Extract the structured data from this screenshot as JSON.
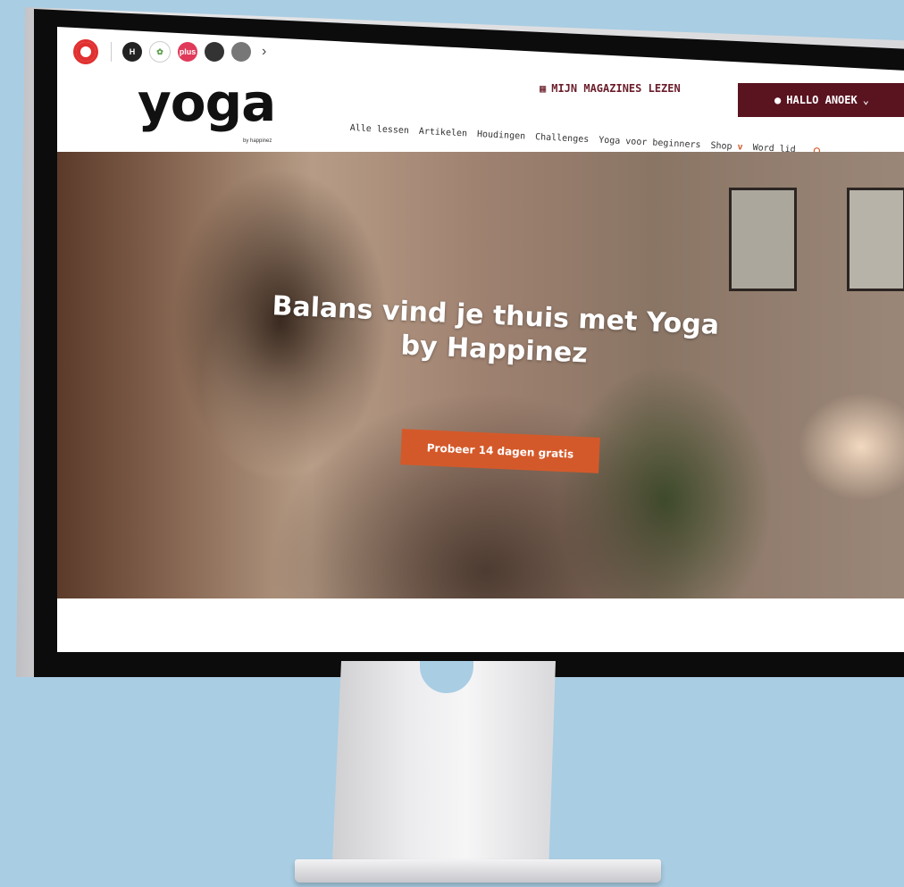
{
  "brands": [
    {
      "name": "opzij-icon",
      "color": "#e03030",
      "label": ""
    },
    {
      "name": "happinez-icon",
      "color": "#222",
      "label": "H"
    },
    {
      "name": "libelle-icon",
      "color": "#5a9e4a",
      "label": ""
    },
    {
      "name": "plus-icon",
      "color": "#e03a5a",
      "label": "plus"
    },
    {
      "name": "brand-dark-icon",
      "color": "#333",
      "label": ""
    },
    {
      "name": "brand-grey-icon",
      "color": "#777",
      "label": ""
    }
  ],
  "header": {
    "logo": "yoga",
    "logo_sub": "by happinez",
    "magazines_label": "MIJN MAGAZINES LEZEN",
    "user_label": "HALLO ANOEK"
  },
  "nav": {
    "items": [
      "Alle lessen",
      "Artikelen",
      "Houdingen",
      "Challenges",
      "Yoga voor beginners",
      "Shop",
      "Word lid"
    ]
  },
  "hero": {
    "title": "Balans vind je thuis met Yoga by Happinez",
    "cta": "Probeer 14 dagen gratis"
  },
  "colors": {
    "accent": "#d4592a",
    "brand": "#5a1420",
    "background": "#a9cde3"
  }
}
